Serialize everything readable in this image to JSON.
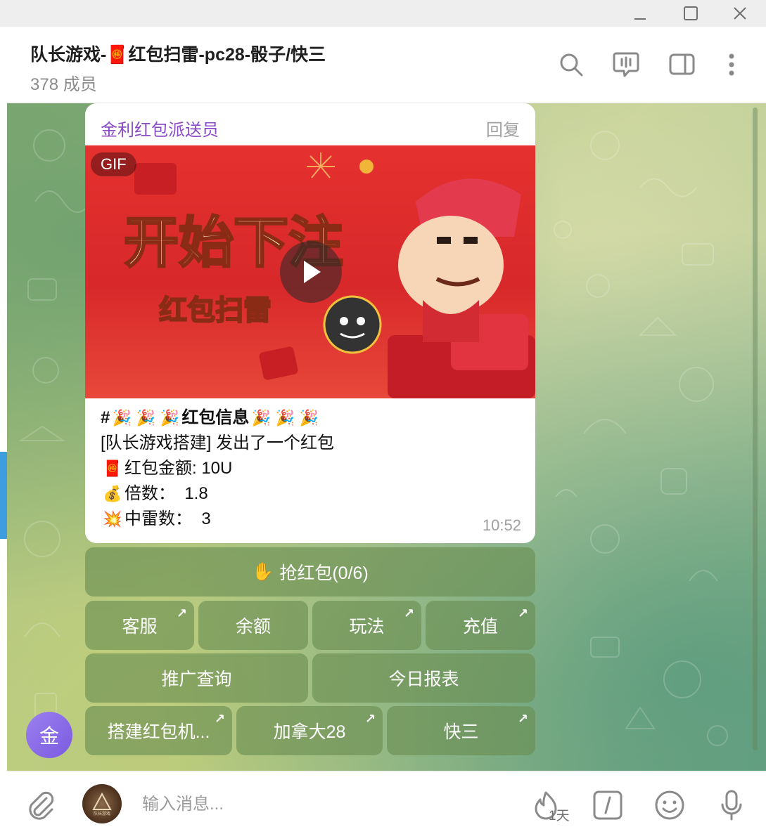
{
  "window": {
    "min_icon": "minimize-icon",
    "max_icon": "maximize-icon",
    "close_icon": "close-icon"
  },
  "header": {
    "title_prefix": "队长游戏-",
    "title_icon": "🧧",
    "title_suffix": "红包扫雷-pc28-骰子/快三",
    "subtitle": "378 成员",
    "icons": [
      "search-icon",
      "livestream-icon",
      "sidebar-toggle-icon",
      "more-icon"
    ]
  },
  "message": {
    "sender": "金利红包派送员",
    "reply_label": "回复",
    "gif_badge": "GIF",
    "gif_text_big": "开始下注",
    "gif_text_small": "红包扫雷",
    "lines": {
      "title_hash": "#",
      "party": "🎉",
      "title": "红包信息",
      "sent_by": "[队长游戏搭建] 发出了一个红包",
      "amount_icon": "🧧",
      "amount": "红包金额: 10U",
      "multiplier_icon": "💰",
      "multiplier": "倍数：  1.8",
      "mines_icon": "💥",
      "mines": "中雷数：  3"
    },
    "time": "10:52"
  },
  "keyboard": {
    "grab": "抢红包(0/6)",
    "grab_icon": "✋",
    "row2": [
      "客服",
      "余额",
      "玩法",
      "充值"
    ],
    "row3": [
      "推广查询",
      "今日报表"
    ],
    "row4": [
      "搭建红包机...",
      "加拿大28",
      "快三"
    ],
    "arrow": "↗"
  },
  "avatar_letter": "金",
  "composer": {
    "placeholder": "输入消息...",
    "timer_label": "1天",
    "bot_avatar_text": "队长游戏",
    "icons": [
      "attach-icon",
      "timer-icon",
      "command-icon",
      "emoji-icon",
      "microphone-icon"
    ]
  },
  "colors": {
    "sender": "#8a4bc6",
    "accent": "#3e9ddf",
    "keyboard_button": "#698c50"
  }
}
